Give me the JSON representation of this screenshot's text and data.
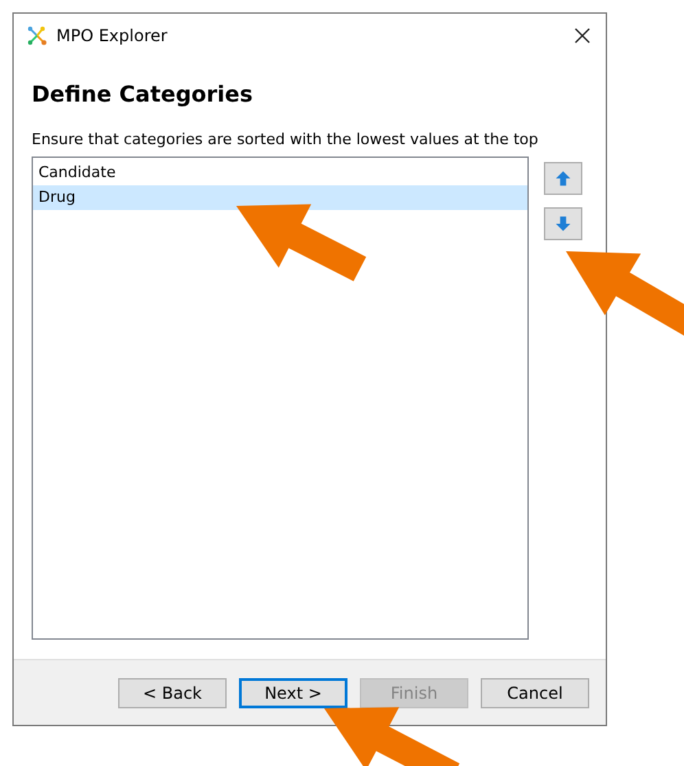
{
  "window": {
    "title": "MPO Explorer"
  },
  "heading": "Define Categories",
  "instruction": "Ensure that categories are sorted with the lowest values at the top",
  "categories": [
    {
      "label": "Candidate",
      "selected": false
    },
    {
      "label": "Drug",
      "selected": true
    }
  ],
  "move_buttons": [
    {
      "kind": "up"
    },
    {
      "kind": "down"
    }
  ],
  "buttons": [
    {
      "label": "< Back",
      "disabled": false,
      "focused": false
    },
    {
      "label": "Next >",
      "disabled": false,
      "focused": true
    },
    {
      "label": "Finish",
      "disabled": true,
      "focused": false
    },
    {
      "label": "Cancel",
      "disabled": false,
      "focused": false
    }
  ]
}
